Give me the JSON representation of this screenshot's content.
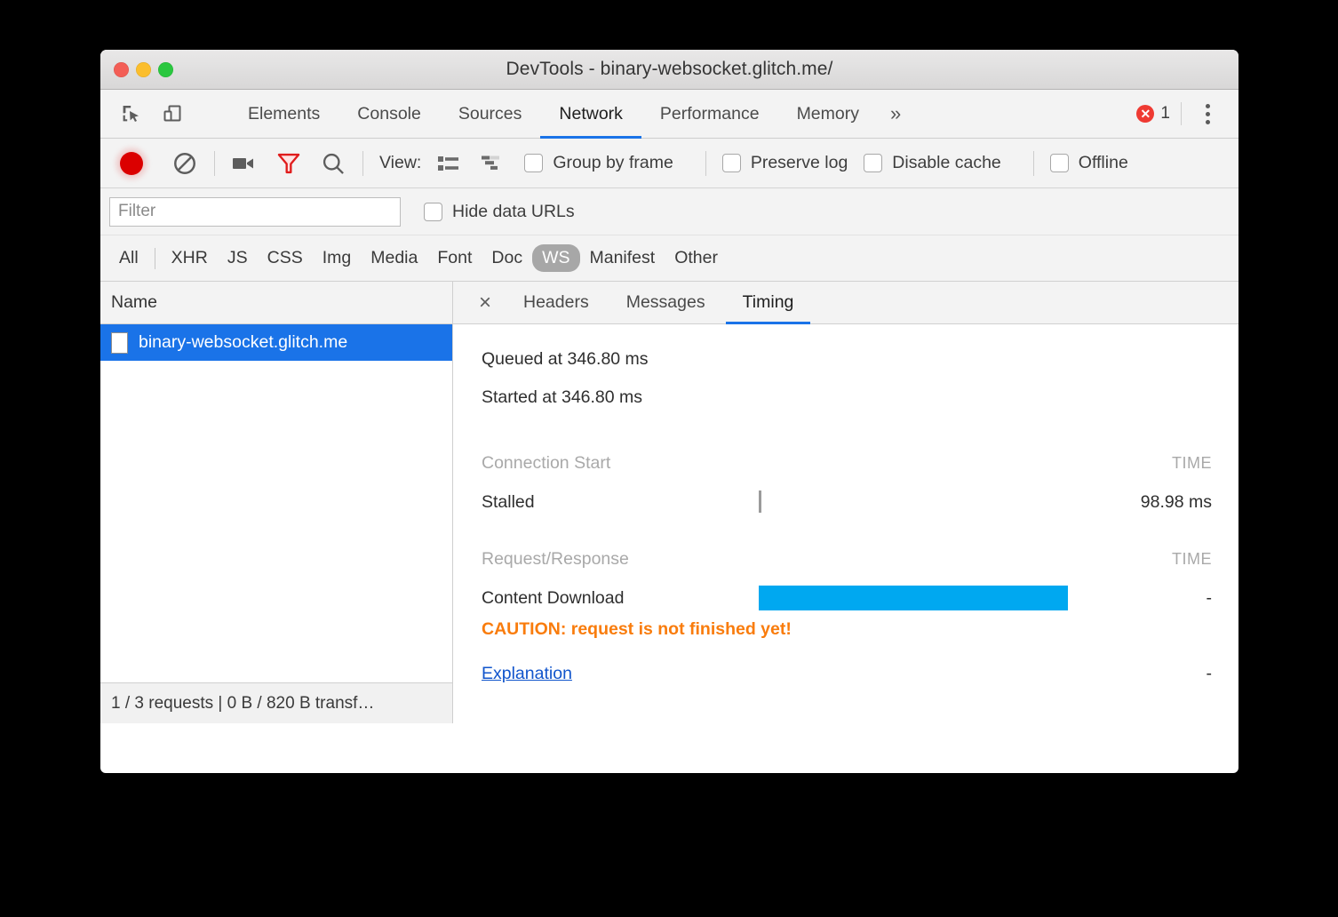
{
  "window": {
    "title": "DevTools - binary-websocket.glitch.me/",
    "traffic_lights": [
      "close-button",
      "minimize-button",
      "maximize-button"
    ]
  },
  "devtools_tabs": {
    "items": [
      {
        "label": "Elements",
        "active": false
      },
      {
        "label": "Console",
        "active": false
      },
      {
        "label": "Sources",
        "active": false
      },
      {
        "label": "Network",
        "active": true
      },
      {
        "label": "Performance",
        "active": false
      },
      {
        "label": "Memory",
        "active": false
      }
    ],
    "overflow_label": "»",
    "error_count": "1"
  },
  "network_toolbar": {
    "record_title": "record-button",
    "clear_title": "clear-button",
    "camera_title": "capture-screenshots-button",
    "filter_title": "filter-button",
    "search_title": "search-button",
    "view_label": "View:",
    "checkboxes": [
      {
        "label": "Group by frame",
        "checked": false
      },
      {
        "label": "Preserve log",
        "checked": false
      },
      {
        "label": "Disable cache",
        "checked": false
      },
      {
        "label": "Offline",
        "checked": false
      }
    ]
  },
  "filter_row": {
    "input_value": "",
    "input_placeholder": "Filter",
    "hide_data_urls_label": "Hide data URLs",
    "hide_data_urls_checked": false
  },
  "type_filters": {
    "all_label": "All",
    "items": [
      {
        "label": "XHR",
        "active": false
      },
      {
        "label": "JS",
        "active": false
      },
      {
        "label": "CSS",
        "active": false
      },
      {
        "label": "Img",
        "active": false
      },
      {
        "label": "Media",
        "active": false
      },
      {
        "label": "Font",
        "active": false
      },
      {
        "label": "Doc",
        "active": false
      },
      {
        "label": "WS",
        "active": true
      },
      {
        "label": "Manifest",
        "active": false
      },
      {
        "label": "Other",
        "active": false
      }
    ]
  },
  "request_list": {
    "column_header": "Name",
    "rows": [
      {
        "name": "binary-websocket.glitch.me",
        "selected": true
      }
    ],
    "status_bar": "1 / 3 requests | 0 B / 820 B transf…"
  },
  "detail_panel": {
    "close_label": "×",
    "tabs": [
      {
        "label": "Headers",
        "active": false
      },
      {
        "label": "Messages",
        "active": false
      },
      {
        "label": "Timing",
        "active": true
      }
    ]
  },
  "timing": {
    "queued": "Queued at 346.80 ms",
    "started": "Started at 346.80 ms",
    "sections": [
      {
        "title": "Connection Start",
        "time_header": "TIME",
        "rows": [
          {
            "label": "Stalled",
            "time": "98.98 ms",
            "bar": "marker"
          }
        ]
      },
      {
        "title": "Request/Response",
        "time_header": "TIME",
        "rows": [
          {
            "label": "Content Download",
            "time": "-",
            "bar": "download"
          }
        ]
      }
    ],
    "caution": "CAUTION: request is not finished yet!",
    "explanation_label": "Explanation",
    "explanation_time": "-",
    "colors": {
      "download_bar": "#00a8f0",
      "stalled_marker": "#9b9b9b",
      "caution_text": "#f97c0c",
      "link": "#1155cc",
      "accent": "#1a73e8"
    }
  }
}
